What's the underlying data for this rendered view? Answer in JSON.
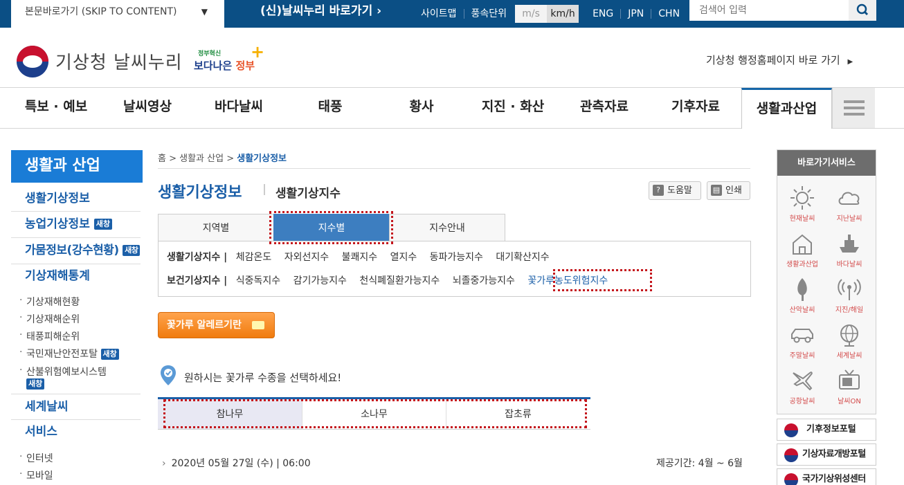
{
  "topbar": {
    "skip": "본문바로가기 (SKIP TO CONTENT)",
    "new_site": "(신)날씨누리 바로가기",
    "sitemap": "사이트맵",
    "wind_unit_label": "풍속단위",
    "units": [
      "m/s",
      "km/h"
    ],
    "langs": [
      "ENG",
      "JPN",
      "CHN"
    ],
    "search_placeholder": "검색어 입력"
  },
  "header": {
    "logo_text": "기상청 날씨누리",
    "gov_small": "정부혁신",
    "gov_main_a": "보다나은",
    "gov_main_b": "정부",
    "admin_link": "기상청 행정홈페이지 바로 가기"
  },
  "gnb": [
    "특보 · 예보",
    "날씨영상",
    "바다날씨",
    "태풍",
    "황사",
    "지진 · 화산",
    "관측자료",
    "기후자료",
    "생활과산업"
  ],
  "lnb": {
    "title": "생활과 산업",
    "items": [
      "생활기상정보",
      "농업기상정보",
      "가뭄정보(강수현황)",
      "기상재해통계"
    ],
    "new_badge": "새창",
    "subs": [
      "기상재해현황",
      "기상재해순위",
      "태풍피해순위",
      "국민재난안전포탈",
      "산불위험예보시스템"
    ],
    "items2": [
      "세계날씨",
      "서비스"
    ],
    "subs2": [
      "인터넷",
      "모바일"
    ]
  },
  "content": {
    "breadcrumb": [
      "홈",
      "생활과 산업",
      "생활기상정보"
    ],
    "title": "생활기상정보",
    "subtitle": "생활기상지수",
    "help": "도움말",
    "print": "인쇄",
    "tabs": [
      "지역별",
      "지수별",
      "지수안내"
    ],
    "row1_label": "생활기상지수 |",
    "row1": [
      "체감온도",
      "자외선지수",
      "불쾌지수",
      "열지수",
      "동파가능지수",
      "대기확산지수"
    ],
    "row2_label": "보건기상지수 |",
    "row2": [
      "식중독지수",
      "감기가능지수",
      "천식폐질환가능지수",
      "뇌졸중가능지수",
      "꽃가루농도위험지수"
    ],
    "alert_btn": "꽃가루 알레르기란",
    "prompt": "원하시는 꽃가루 수종을 선택하세요!",
    "types": [
      "참나무",
      "소나무",
      "잡초류"
    ],
    "date": "2020년 05월 27일 (수) | 06:00",
    "period": "제공기간: 4월 ~ 6월"
  },
  "quick": {
    "title": "바로가기서비스",
    "items": [
      "현재날씨",
      "지난날씨",
      "생활과산업",
      "바다날씨",
      "산악날씨",
      "지진/해일",
      "주말날씨",
      "세계날씨",
      "공항날씨",
      "날씨ON"
    ],
    "portals": [
      "기후정보포털",
      "기상자료개방포털",
      "국가기상위성센터"
    ]
  },
  "colors": {
    "brand_blue": "#0b4f85",
    "accent": "#1b5fa8",
    "highlight": "#c4161c",
    "orange": "#f08a1e"
  }
}
